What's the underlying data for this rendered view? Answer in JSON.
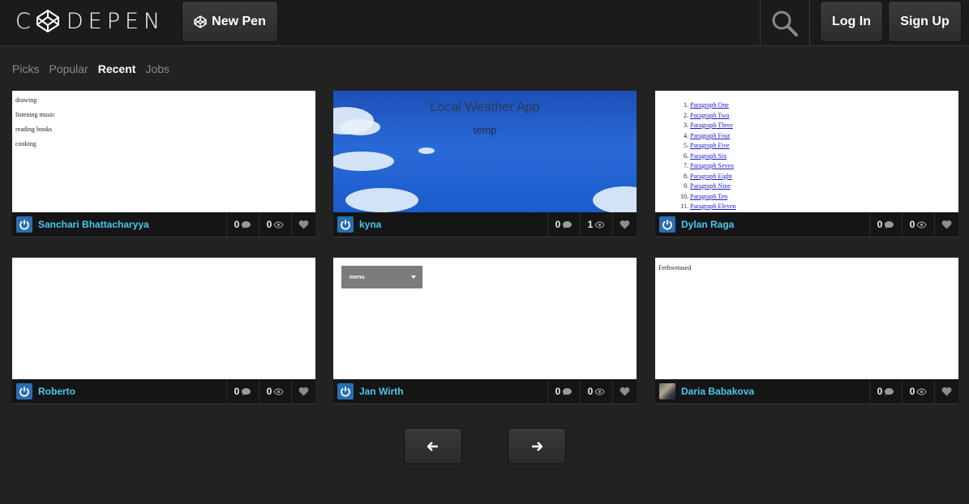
{
  "app": {
    "logo_text_left": "C",
    "logo_text_right": "DEPEN"
  },
  "header": {
    "new_pen_label": "New Pen",
    "login_label": "Log In",
    "signup_label": "Sign Up"
  },
  "tabs": [
    {
      "label": "Picks",
      "active": false
    },
    {
      "label": "Popular",
      "active": false
    },
    {
      "label": "Recent",
      "active": true
    },
    {
      "label": "Jobs",
      "active": false
    }
  ],
  "cards": [
    {
      "owner": "Sanchari Bhattacharyya",
      "comments": "0",
      "views": "0",
      "preview": {
        "items": [
          "drawing",
          "listening music",
          "reading books",
          "cooking"
        ]
      }
    },
    {
      "owner": "kyna",
      "comments": "0",
      "views": "1",
      "preview": {
        "title": "Local Weather App",
        "subtitle": "temp"
      }
    },
    {
      "owner": "Dylan Raga",
      "comments": "0",
      "views": "0",
      "preview": {
        "items": [
          "Paragraph One",
          "Paragraph Two",
          "Paragraph Three",
          "Paragraph Four",
          "Paragraph Five",
          "Paragraph Six",
          "Paragraph Seven",
          "Paragraph Eight",
          "Paragraph Nine",
          "Paragraph Ten",
          "Paragraph Eleven"
        ]
      }
    },
    {
      "owner": "Roberto",
      "comments": "0",
      "views": "0",
      "preview": {}
    },
    {
      "owner": "Jan Wirth",
      "comments": "0",
      "views": "0",
      "preview": {
        "menu_label": "menu"
      }
    },
    {
      "owner": "Daria Babakova",
      "comments": "0",
      "views": "0",
      "preview": {
        "text": "Ferhwetased"
      }
    }
  ],
  "colors": {
    "accent_link": "#48c7ef",
    "background": "#222223",
    "header": "#1b1b1c"
  },
  "icons": [
    "codepen-logo-icon",
    "search-icon",
    "comment-icon",
    "eye-icon",
    "heart-icon",
    "arrow-left-icon",
    "arrow-right-icon",
    "power-avatar-icon"
  ]
}
